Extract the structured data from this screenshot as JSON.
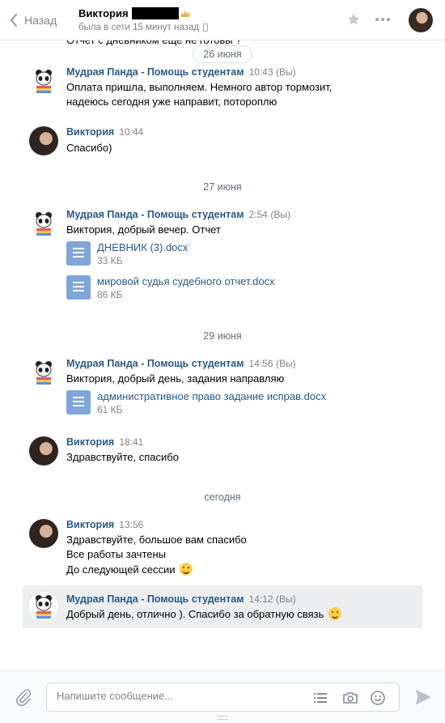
{
  "header": {
    "back_label": "Назад",
    "contact_name": "Виктория",
    "status": "была в сети 15 минут назад"
  },
  "chat": {
    "clipped_message": "Отчет с дневником еще не готовы ?",
    "dates": [
      "26 июня",
      "27 июня",
      "29 июня",
      "сегодня"
    ],
    "messages": [
      {
        "author": "Мудрая Панда - Помощь студентам",
        "time": "10:43",
        "you": "(Вы)",
        "lines": [
          "Оплата пришла, выполняем. Немного автор тормозит,",
          "надеюсь сегодня уже направит, потороплю"
        ]
      },
      {
        "author": "Виктория",
        "time": "10:44",
        "lines": [
          "Спасибо)"
        ]
      },
      {
        "author": "Мудрая Панда - Помощь студентам",
        "time": "2:54",
        "you": "(Вы)",
        "lines": [
          "Виктория, добрый вечер. Отчет"
        ],
        "docs": [
          {
            "name": "ДНЕВНИК (3).docx",
            "size": "33 КБ"
          },
          {
            "name": "мировой судья судебного отчет.docx",
            "size": "86 КБ"
          }
        ]
      },
      {
        "author": "Мудрая Панда - Помощь студентам",
        "time": "14:56",
        "you": "(Вы)",
        "lines": [
          "Виктория, добрый день, задания направляю"
        ],
        "docs": [
          {
            "name": "административное право задание исправ.docx",
            "size": "61 КБ"
          }
        ]
      },
      {
        "author": "Виктория",
        "time": "18:41",
        "lines": [
          "Здравствуйте, спасибо"
        ]
      },
      {
        "author": "Виктория",
        "time": "13:56",
        "lines": [
          "Здравствуйте, большое вам спасибо",
          "Все работы зачтены",
          "До следующей сессии"
        ]
      },
      {
        "author": "Мудрая Панда - Помощь студентам",
        "time": "14:12",
        "you": "(Вы)",
        "lines": [
          "Добрый день, отлично ). Спасибо за обратную связь"
        ]
      }
    ]
  },
  "composer": {
    "placeholder": "Напишите сообщение..."
  },
  "colors": {
    "link": "#2a5885",
    "muted": "#828282",
    "doc_icon": "#80a5d8",
    "highlight_bg": "#edeef0"
  }
}
